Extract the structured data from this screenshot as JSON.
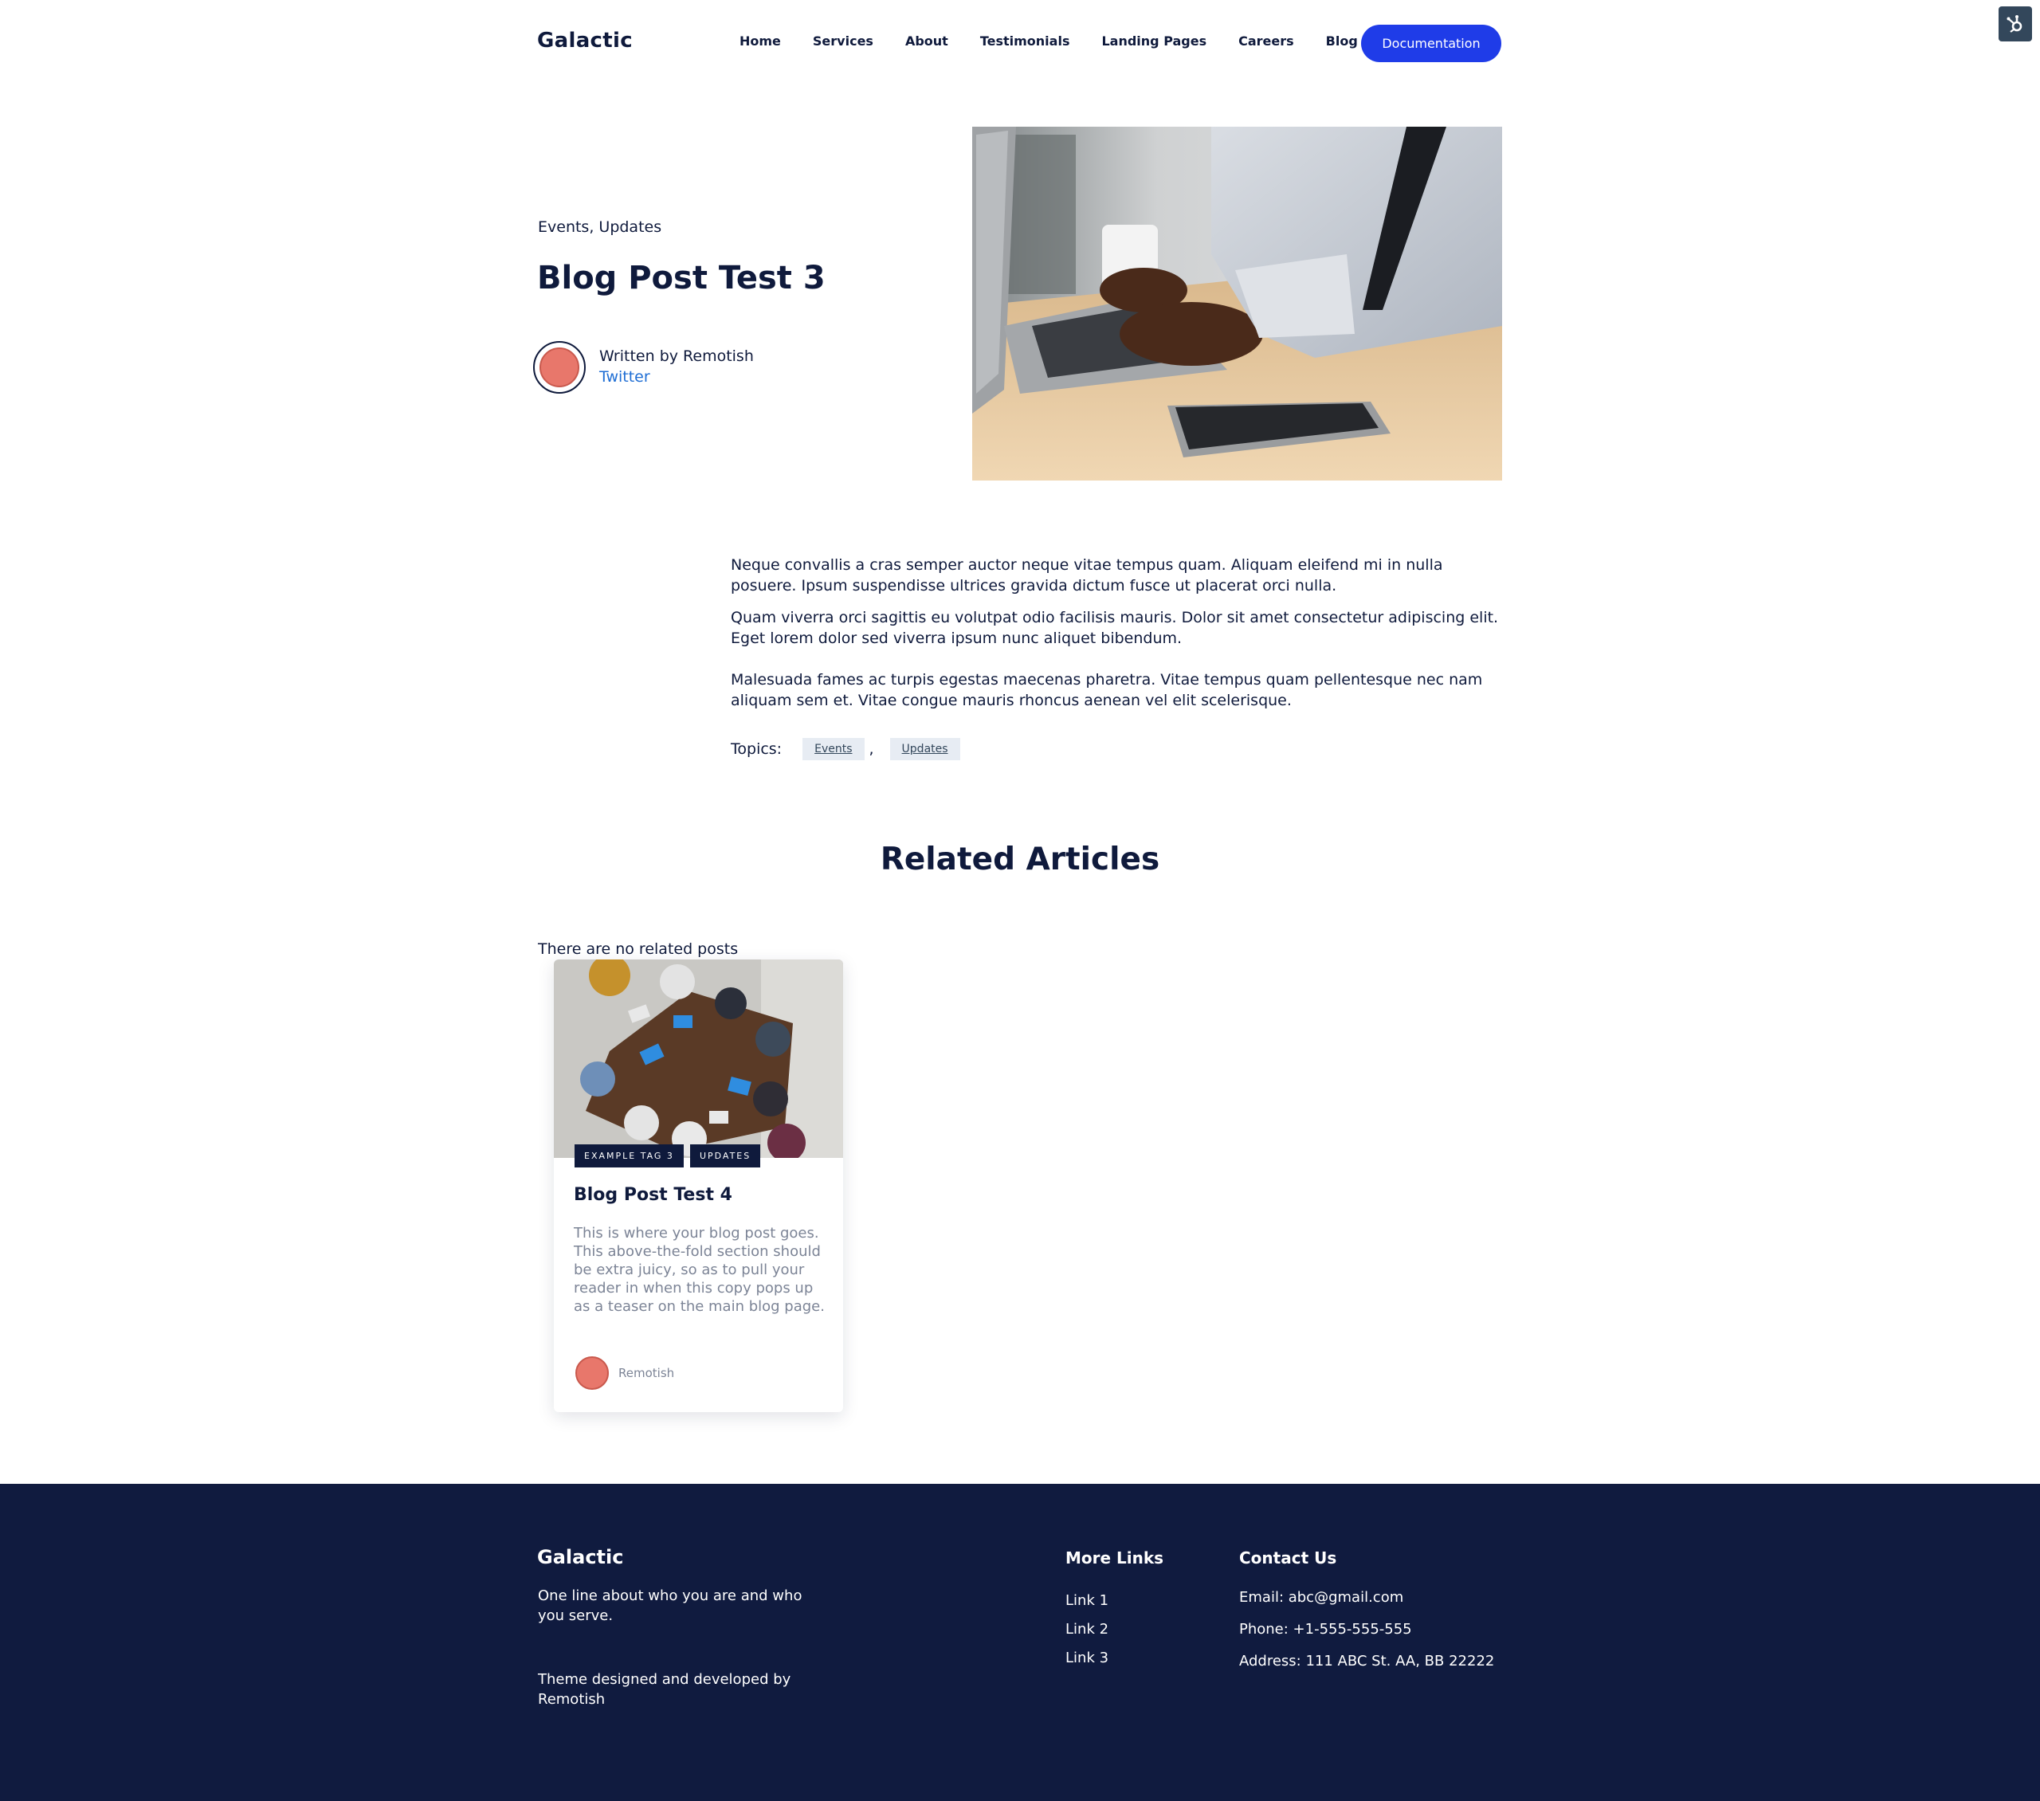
{
  "header": {
    "logo": "Galactic",
    "nav": [
      "Home",
      "Services",
      "About",
      "Testimonials",
      "Landing Pages",
      "Careers",
      "Blog"
    ],
    "cta": "Documentation"
  },
  "post": {
    "categories": "Events, Updates",
    "title": "Blog Post Test 3",
    "author_line": "Written by Remotish",
    "author_social": "Twitter",
    "paragraphs": [
      "Neque convallis a cras semper auctor neque vitae tempus quam. Aliquam eleifend mi in nulla posuere. Ipsum suspendisse ultrices gravida dictum fusce ut placerat orci nulla.",
      "Quam viverra orci sagittis eu volutpat odio facilisis mauris. Dolor sit amet consectetur adipiscing elit. Eget lorem dolor sed viverra ipsum nunc aliquet bibendum.",
      "Malesuada fames ac turpis egestas maecenas pharetra. Vitae tempus quam pellentesque nec nam aliquam sem et. Vitae congue mauris rhoncus aenean vel elit scelerisque."
    ],
    "topics_label": "Topics:",
    "topics": [
      "Events",
      "Updates"
    ],
    "topics_separator": ","
  },
  "related": {
    "title": "Related Articles",
    "empty_text": "There are no related posts",
    "card": {
      "tags": [
        "EXAMPLE TAG 3",
        "UPDATES"
      ],
      "title": "Blog Post Test 4",
      "excerpt": "This is where your blog post goes. This above-the-fold section should be extra juicy, so as to pull your reader in when this copy pops up as a teaser on the main blog page.",
      "author": "Remotish"
    }
  },
  "footer": {
    "logo": "Galactic",
    "about": "One line about who you are and who you serve.",
    "credit": "Theme designed and developed by Remotish",
    "more_links_title": "More Links",
    "links": [
      "Link 1",
      "Link 2",
      "Link 3"
    ],
    "contact_title": "Contact Us",
    "email": "Email: abc@gmail.com",
    "phone": "Phone: +1-555-555-555",
    "address": "Address: 111 ABC St. AA, BB 22222"
  },
  "colors": {
    "navy": "#0f1a3c",
    "footer_bg": "#101b3f",
    "cta_blue": "#1f3ce8",
    "link_blue": "#1f6ed4",
    "avatar": "#e8776b"
  },
  "icons": [
    "hubspot-sprocket-icon"
  ]
}
